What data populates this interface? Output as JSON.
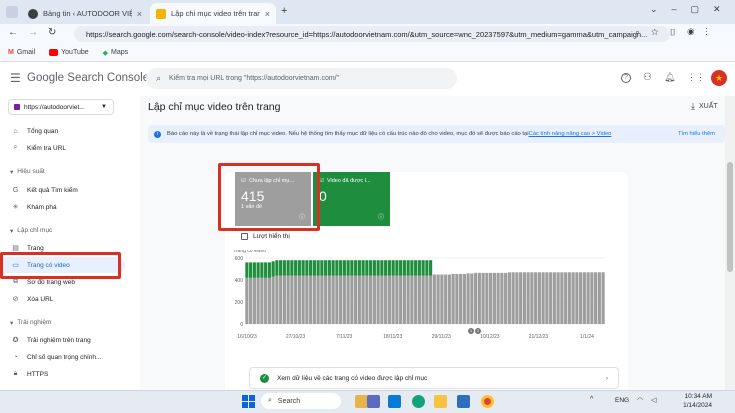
{
  "browser": {
    "tabs": [
      {
        "title": "Bảng tin ‹ AUTODOOR VIỆT NA",
        "active": false
      },
      {
        "title": "Lập chỉ mục video trên trang",
        "active": true
      }
    ],
    "url": "https://search.google.com/search-console/video-index?resource_id=https://autodoorvietnam.com/&utm_source=wnc_20237597&utm_medium=gamma&utm_campaign...",
    "bookmarks": [
      "Gmail",
      "YouTube",
      "Maps"
    ]
  },
  "header": {
    "product": "Google Search Console",
    "search_placeholder": "Kiểm tra mọi URL trong \"https://autodoorvietnam.com/\""
  },
  "sidebar": {
    "property": "https://autodoorviet...",
    "top_items": [
      {
        "label": "Tổng quan",
        "icon": "home-icon"
      },
      {
        "label": "Kiểm tra URL",
        "icon": "search-icon"
      }
    ],
    "sections": [
      {
        "title": "Hiệu suất",
        "items": [
          {
            "label": "Kết quả Tìm kiếm"
          },
          {
            "label": "Khám phá"
          }
        ]
      },
      {
        "title": "Lập chỉ mục",
        "items": [
          {
            "label": "Trang"
          },
          {
            "label": "Trang có video",
            "selected": true
          },
          {
            "label": "Sơ đồ trang web"
          },
          {
            "label": "Xóa URL"
          }
        ]
      },
      {
        "title": "Trải nghiệm",
        "items": [
          {
            "label": "Trải nghiệm trên trang"
          },
          {
            "label": "Chỉ số quan trọng chính..."
          },
          {
            "label": "HTTPS"
          }
        ]
      }
    ]
  },
  "main": {
    "page_title": "Lập chỉ mục video trên trang",
    "export_label": "XUẤT",
    "info_text": "Báo cáo này là về trạng thái lập chỉ mục video. Nếu hệ thống tìm thấy mục dữ liệu có cấu trúc nào đó cho video, mục đó sẽ được báo cáo tại ",
    "info_link": "Các tính năng nâng cao > Video",
    "info_more": "Tìm hiểu thêm",
    "tiles": [
      {
        "label": "Chưa lập chỉ mụ...",
        "value": "415",
        "sub": "1 vấn đề",
        "color": "#9e9e9e"
      },
      {
        "label": "Video đã được l...",
        "value": "0",
        "sub": "",
        "color": "#1e8e3e"
      }
    ],
    "checkbox_label": "Lượt hiển thị",
    "footer_link": "Xem dữ liệu về các trang có video được lập chỉ mục"
  },
  "chart_data": {
    "type": "bar",
    "ylabel": "Trang có video",
    "ylim": [
      0,
      600
    ],
    "yticks": [
      "600",
      "400",
      "200",
      "0"
    ],
    "xticks": [
      "16/10/23",
      "27/10/23",
      "7/11/23",
      "18/11/23",
      "29/11/23",
      "10/12/23",
      "21/12/23",
      "1/1/24"
    ],
    "stacked": true,
    "series": [
      {
        "color": "#9e9e9e",
        "values": [
          420,
          420,
          420,
          420,
          420,
          420,
          420,
          430,
          440,
          440,
          440,
          440,
          440,
          440,
          440,
          440,
          440,
          440,
          440,
          440,
          440,
          440,
          440,
          440,
          440,
          440,
          440,
          440,
          440,
          440,
          440,
          440,
          440,
          440,
          440,
          440,
          440,
          440,
          440,
          440,
          440,
          440,
          440,
          440,
          440,
          440,
          440,
          440,
          440,
          440,
          450,
          450,
          450,
          450,
          450,
          455,
          455,
          455,
          455,
          460,
          460,
          465,
          465,
          465,
          465,
          465,
          465,
          465,
          465,
          465,
          470,
          470,
          470,
          470,
          470,
          470,
          470,
          470,
          470,
          470,
          470,
          470,
          470,
          470,
          470,
          470,
          470,
          470,
          470,
          470,
          470,
          470,
          470,
          470,
          470,
          470
        ]
      },
      {
        "color": "#1e8e3e",
        "values": [
          140,
          140,
          140,
          140,
          140,
          140,
          140,
          140,
          140,
          140,
          140,
          140,
          140,
          140,
          140,
          140,
          140,
          140,
          140,
          140,
          140,
          140,
          140,
          140,
          140,
          140,
          140,
          140,
          140,
          140,
          140,
          140,
          140,
          140,
          140,
          140,
          140,
          140,
          140,
          140,
          140,
          140,
          140,
          140,
          140,
          140,
          140,
          140,
          140,
          140,
          0,
          0,
          0,
          0,
          0,
          0,
          0,
          0,
          0,
          0,
          0,
          0,
          0,
          0,
          0,
          0,
          0,
          0,
          0,
          0,
          0,
          0,
          0,
          0,
          0,
          0,
          0,
          0,
          0,
          0,
          0,
          0,
          0,
          0,
          0,
          0,
          0,
          0,
          0,
          0,
          0,
          0,
          0,
          0,
          0,
          0
        ]
      }
    ]
  },
  "taskbar": {
    "search": "Search",
    "time": "10:34 AM",
    "date": "1/14/2024",
    "lang": "ENG"
  }
}
